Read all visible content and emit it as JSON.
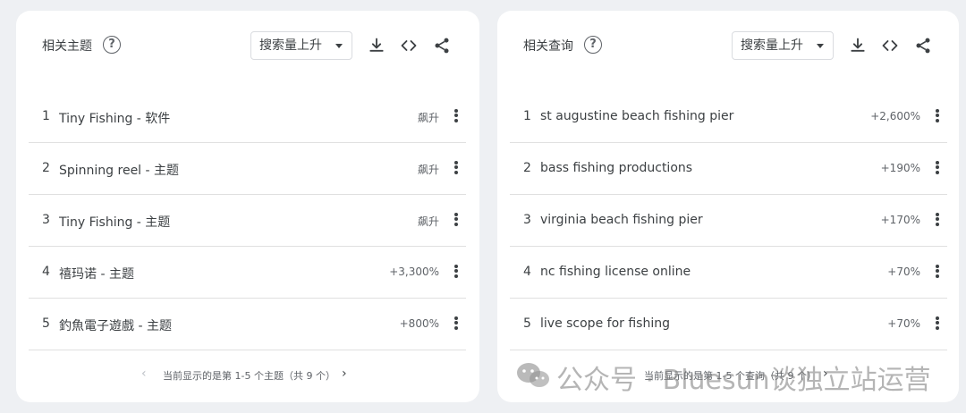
{
  "panels": [
    {
      "title": "相关主题",
      "sort_label": "搜索量上升",
      "rows": [
        {
          "index": "1",
          "label": "Tiny Fishing - 软件",
          "value": "飙升"
        },
        {
          "index": "2",
          "label": "Spinning reel - 主题",
          "value": "飙升"
        },
        {
          "index": "3",
          "label": "Tiny Fishing - 主题",
          "value": "飙升"
        },
        {
          "index": "4",
          "label": "禧玛诺 - 主题",
          "value": "+3,300%"
        },
        {
          "index": "5",
          "label": "釣魚電子遊戲 - 主题",
          "value": "+800%"
        }
      ],
      "pager_text": "当前显示的是第 1-5 个主题（共 9 个）"
    },
    {
      "title": "相关查询",
      "sort_label": "搜索量上升",
      "rows": [
        {
          "index": "1",
          "label": "st augustine beach fishing pier",
          "value": "+2,600%"
        },
        {
          "index": "2",
          "label": "bass fishing productions",
          "value": "+190%"
        },
        {
          "index": "3",
          "label": "virginia beach fishing pier",
          "value": "+170%"
        },
        {
          "index": "4",
          "label": "nc fishing license online",
          "value": "+70%"
        },
        {
          "index": "5",
          "label": "live scope for fishing",
          "value": "+70%"
        }
      ],
      "pager_text": "当前显示的是第 1-5 个查询（共 9 个）"
    }
  ],
  "icons": {
    "help": "help-circle-icon",
    "download": "download-icon",
    "embed": "code-embed-icon",
    "share": "share-icon",
    "row_menu": "more-vert-icon",
    "prev": "chevron-left-icon",
    "next": "chevron-right-icon"
  },
  "help_glyph": "?",
  "prev_glyph": "‹",
  "next_glyph": "›",
  "watermark": {
    "text": "公众号 · Bluesun谈独立站运营"
  }
}
